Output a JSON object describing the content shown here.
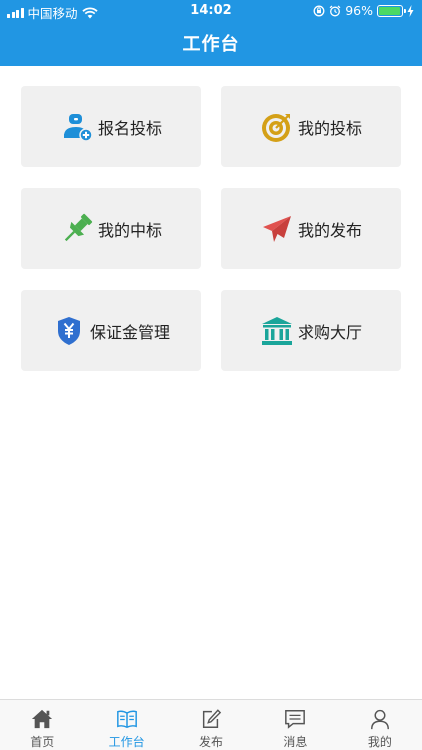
{
  "status_bar": {
    "carrier": "中国移动",
    "time": "14:02",
    "battery": "96%",
    "battery_level": 0.96
  },
  "header": {
    "title": "工作台"
  },
  "menu": [
    {
      "label": "报名投标",
      "icon": "signup-user-icon",
      "color": "#1e8fd8"
    },
    {
      "label": "我的投标",
      "icon": "target-icon",
      "color": "#d4a017"
    },
    {
      "label": "我的中标",
      "icon": "pushpin-icon",
      "color": "#4caf50"
    },
    {
      "label": "我的发布",
      "icon": "paper-plane-icon",
      "color": "#e0524f"
    },
    {
      "label": "保证金管理",
      "icon": "yuan-shield-icon",
      "color": "#2f6fcf"
    },
    {
      "label": "求购大厅",
      "icon": "hall-building-icon",
      "color": "#1aa59a"
    }
  ],
  "tabs": [
    {
      "label": "首页",
      "icon": "home-icon",
      "active": false
    },
    {
      "label": "工作台",
      "icon": "workbench-book-icon",
      "active": true
    },
    {
      "label": "发布",
      "icon": "edit-icon",
      "active": false
    },
    {
      "label": "消息",
      "icon": "message-icon",
      "active": false
    },
    {
      "label": "我的",
      "icon": "user-icon",
      "active": false
    }
  ],
  "colors": {
    "header": "#2196e3",
    "active_tab": "#2196e3",
    "card_bg": "#f0f0f0"
  }
}
